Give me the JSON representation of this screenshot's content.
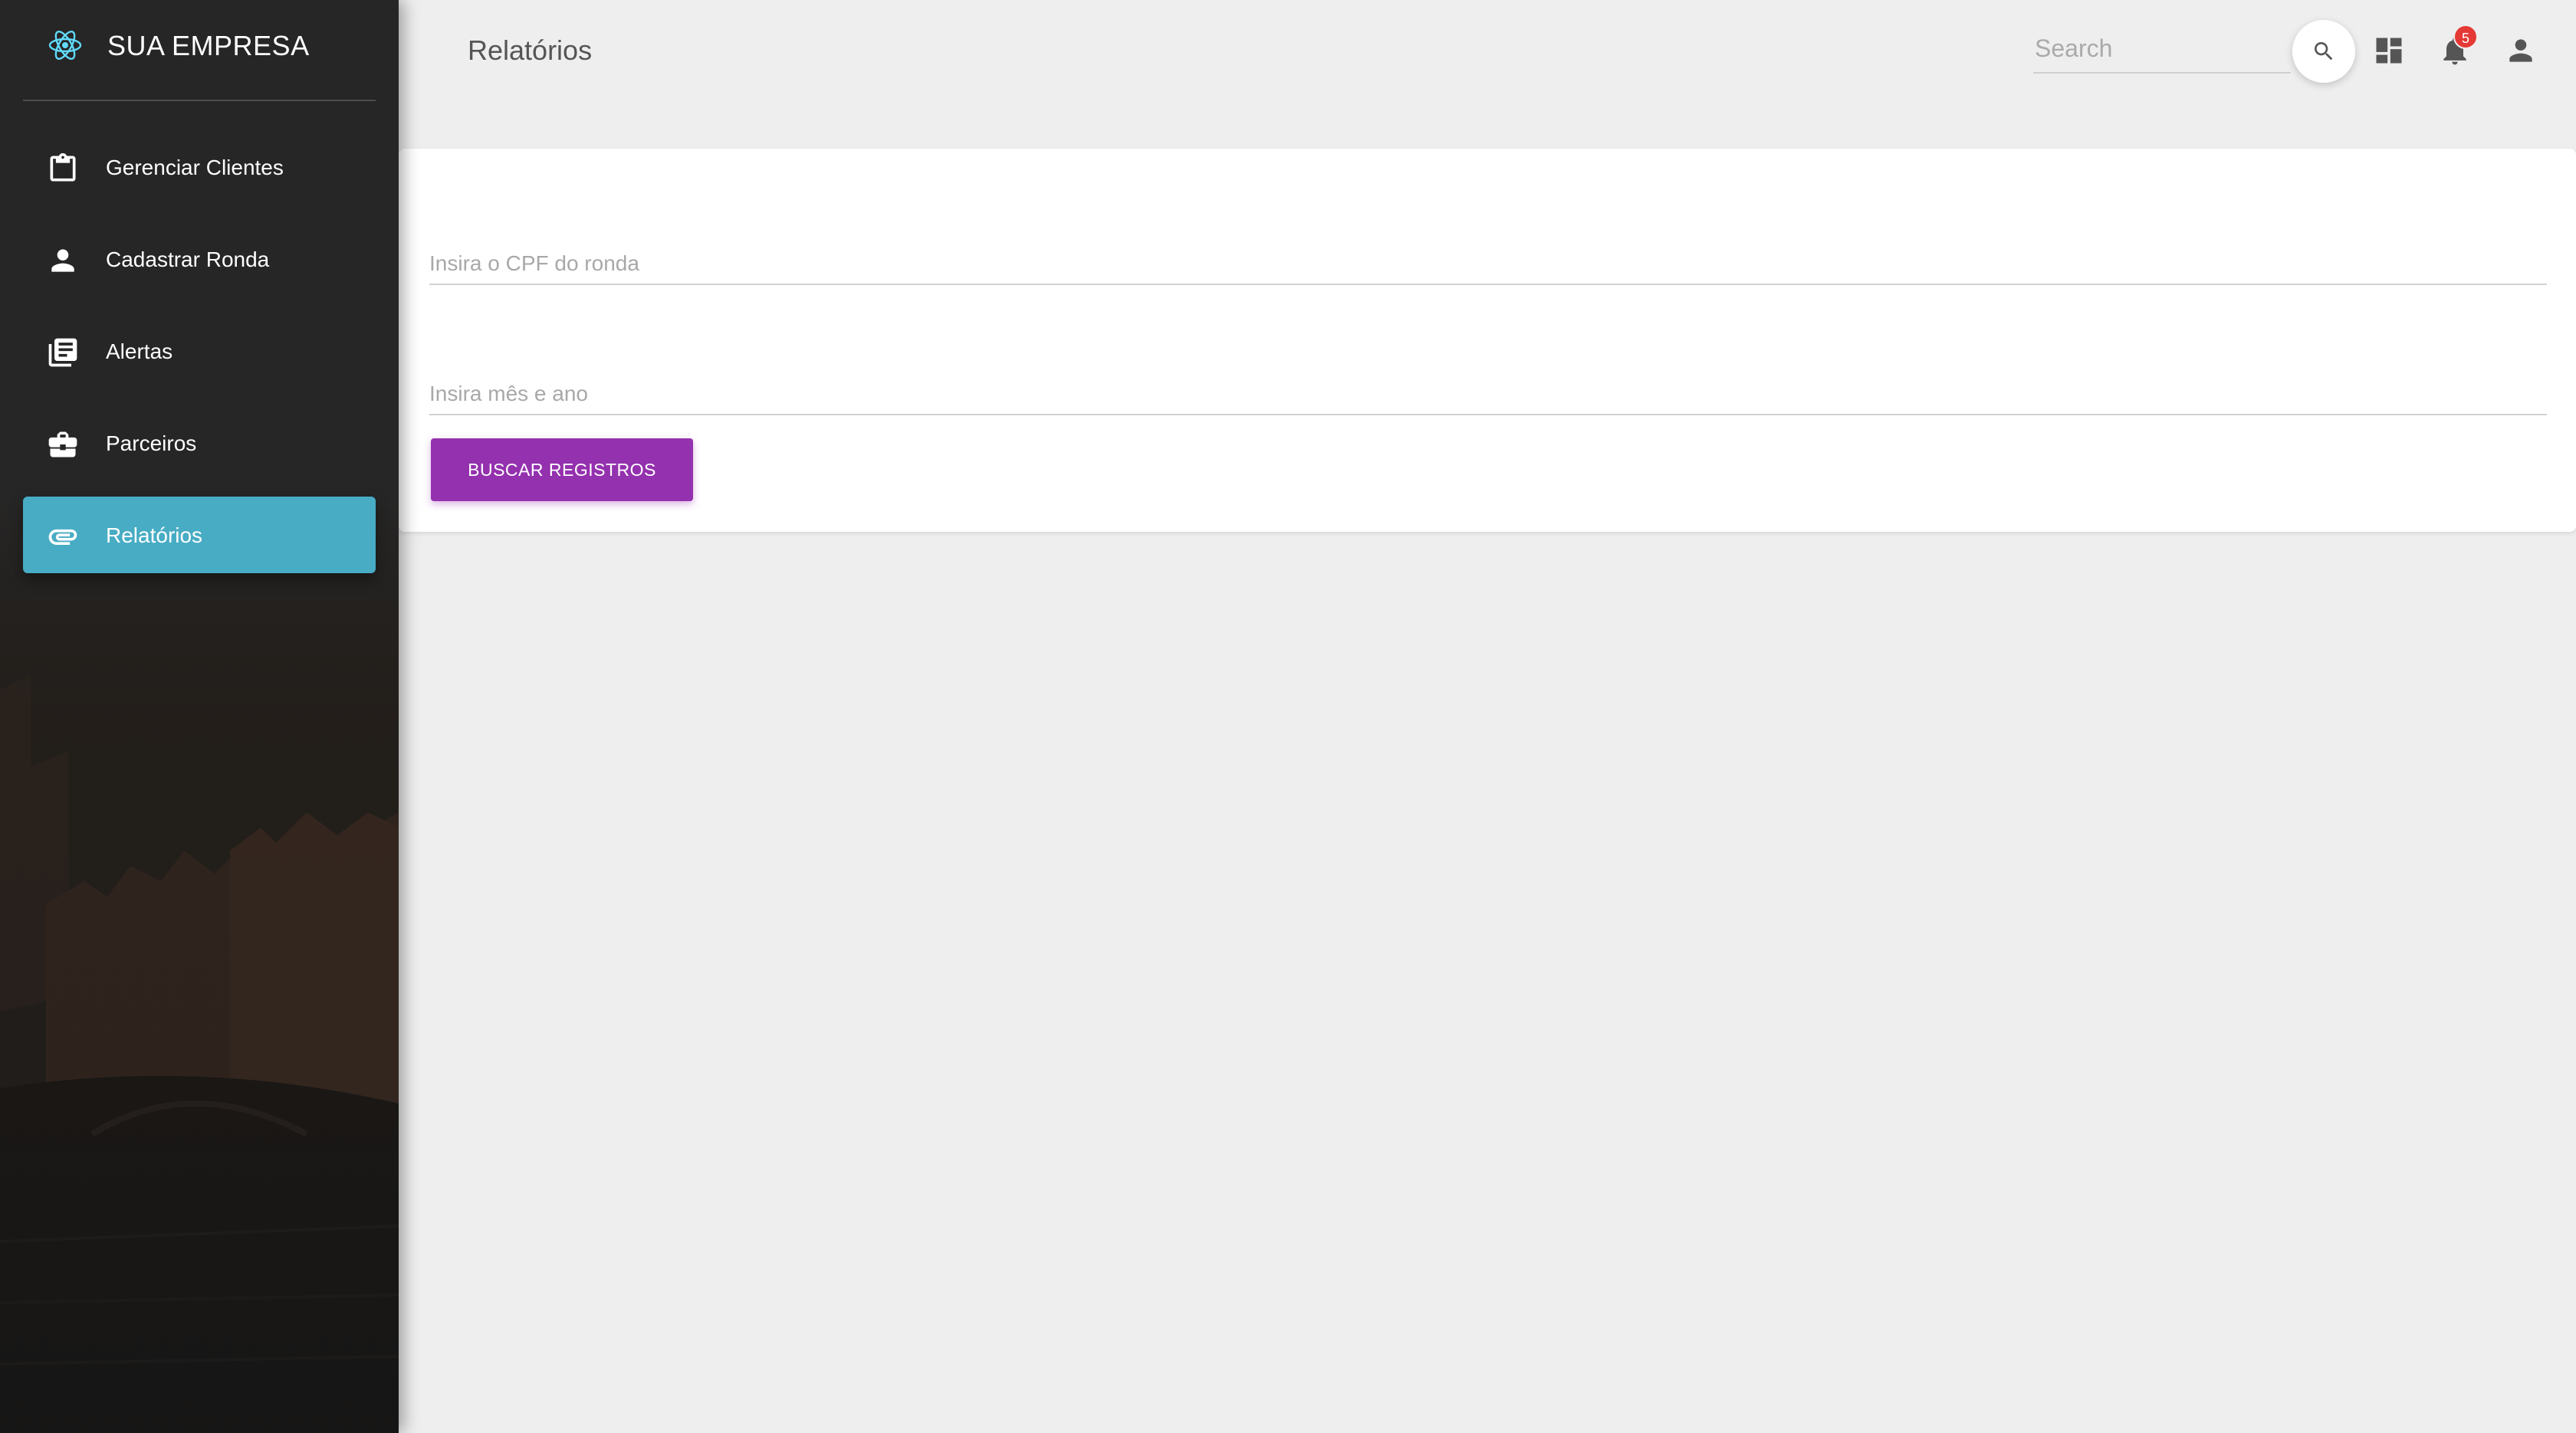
{
  "sidebar": {
    "brand": {
      "name": "SUA EMPRESA",
      "logo_icon": "react-atom-icon"
    },
    "items": [
      {
        "label": "Gerenciar Clientes",
        "icon": "clipboard-icon",
        "active": false
      },
      {
        "label": "Cadastrar Ronda",
        "icon": "person-icon",
        "active": false
      },
      {
        "label": "Alertas",
        "icon": "library-books-icon",
        "active": false
      },
      {
        "label": "Parceiros",
        "icon": "briefcase-icon",
        "active": false
      },
      {
        "label": "Relatórios",
        "icon": "paperclip-icon",
        "active": true
      }
    ]
  },
  "header": {
    "title": "Relatórios",
    "search": {
      "placeholder": "Search",
      "value": ""
    },
    "notifications": {
      "count": "5"
    },
    "icons": [
      "search-icon",
      "dashboard-icon",
      "bell-icon",
      "account-icon"
    ]
  },
  "form": {
    "cpf": {
      "placeholder": "Insira o CPF do ronda",
      "value": ""
    },
    "month_year": {
      "placeholder": "Insira mês e ano",
      "value": ""
    },
    "submit_label": "BUSCAR REGISTROS"
  },
  "colors": {
    "accent_active": "#47acc4",
    "primary_button": "#9431ae",
    "badge": "#e53935",
    "logo": "#61dafb"
  }
}
